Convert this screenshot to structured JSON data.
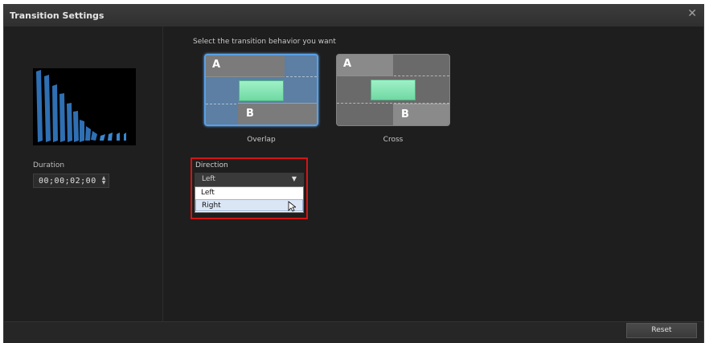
{
  "window": {
    "title": "Transition Settings",
    "close_icon": "close-icon"
  },
  "left_panel": {
    "preview_icon": "transition-preview-thumbnail",
    "duration_label": "Duration",
    "duration_value": "00;00;02;00"
  },
  "behavior": {
    "instruction": "Select the transition behavior you want",
    "options": [
      {
        "name": "Overlap",
        "clip_a": "A",
        "clip_b": "B",
        "selected": true
      },
      {
        "name": "Cross",
        "clip_a": "A",
        "clip_b": "B",
        "selected": false
      }
    ]
  },
  "direction": {
    "label": "Direction",
    "selected": "Left",
    "options": [
      "Left",
      "Right"
    ],
    "hovered": "Right",
    "highlight_color": "#d41414"
  },
  "footer": {
    "reset_label": "Reset"
  },
  "colors": {
    "selection_border": "#5aa0e6",
    "clip_green": "#7ee0b0"
  }
}
